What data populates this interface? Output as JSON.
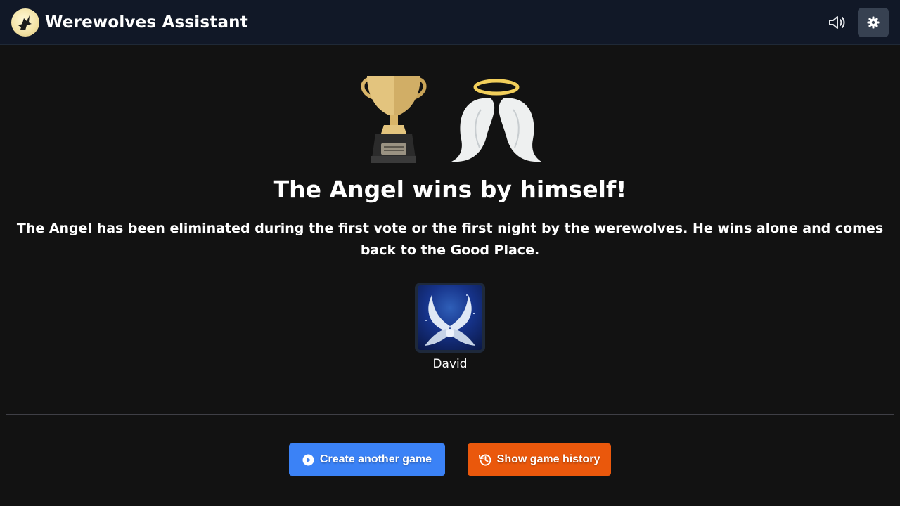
{
  "header": {
    "app_title": "Werewolves Assistant",
    "logo_icon": "werewolf-logo-icon",
    "sound_icon": "volume-icon",
    "settings_icon": "gear-icon"
  },
  "result": {
    "icons": [
      "trophy-icon",
      "angel-wings-icon"
    ],
    "title": "The Angel wins by himself!",
    "description": "The Angel has been eliminated during the first vote or the first night by the werewolves. He wins alone and comes back to the Good Place."
  },
  "winners": [
    {
      "name": "David",
      "role_icon": "angel-role-icon"
    }
  ],
  "actions": {
    "create_label": "Create another game",
    "create_icon": "play-circle-icon",
    "history_label": "Show game history",
    "history_icon": "history-icon"
  },
  "colors": {
    "background": "#121212",
    "navbar": "#111827",
    "create_button": "#3b82f6",
    "history_button": "#ea580c",
    "settings_button": "#374151"
  }
}
